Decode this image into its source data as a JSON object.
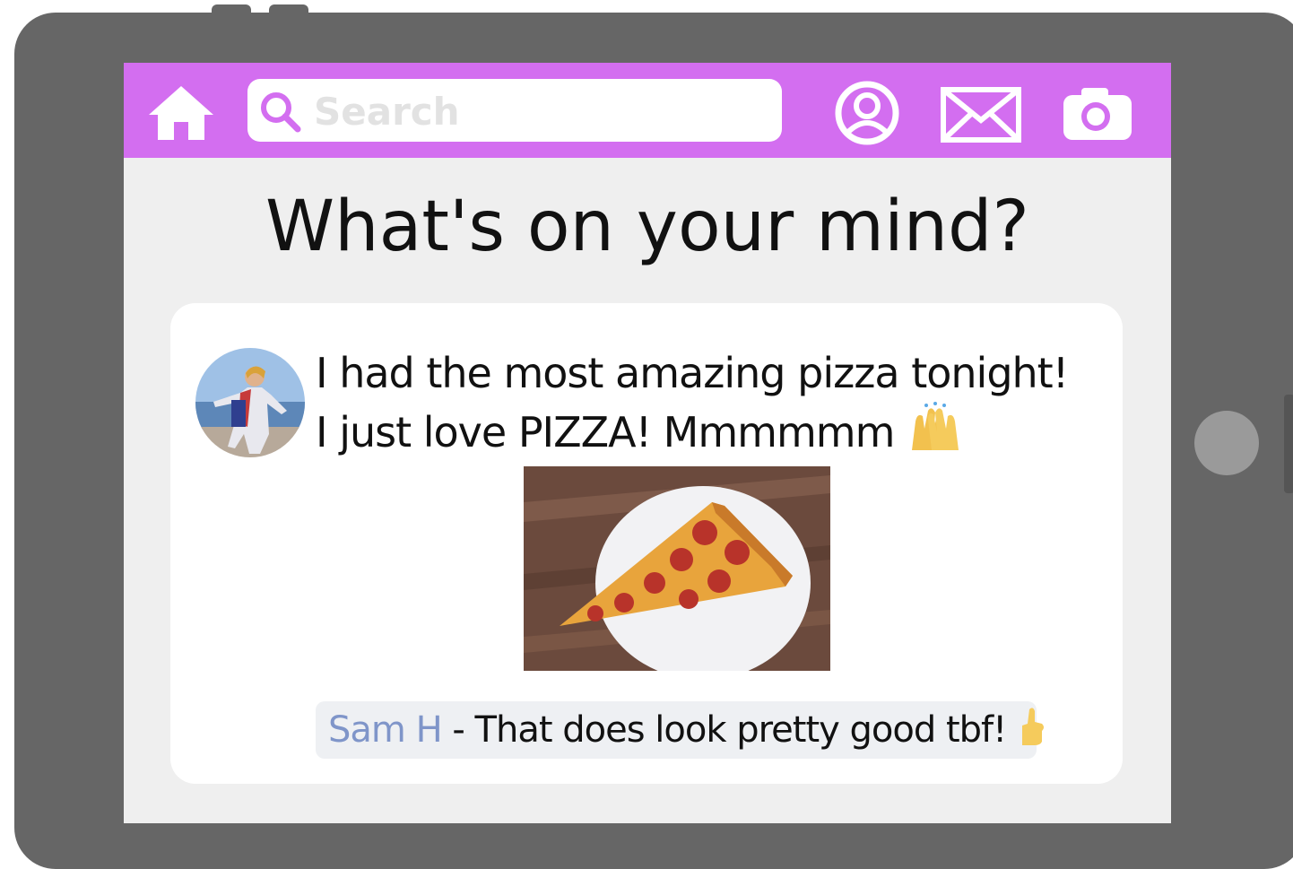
{
  "search": {
    "placeholder": "Search"
  },
  "headline": "What's on your mind?",
  "post": {
    "line1": "I had the most amazing pizza tonight!",
    "line2": "I just love PIZZA! Mmmmmm",
    "emoji": "raising-hands-emoji"
  },
  "comment": {
    "author": "Sam H",
    "separator": " - ",
    "text": "That does look pretty good tbf!",
    "emoji": "thumbs-up-emoji"
  },
  "icons": [
    "home-icon",
    "search-icon",
    "profile-icon",
    "mail-icon",
    "camera-icon"
  ],
  "colors": {
    "topbar": "#d36ef0",
    "device": "#666666",
    "screen": "#efefef",
    "comment_author": "#7f95c9"
  }
}
